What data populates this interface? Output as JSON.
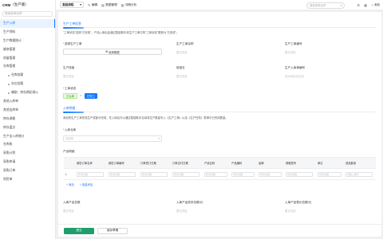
{
  "sidebar": {
    "brand": "CRM",
    "brand_sub": "（生产版）",
    "search_placeholder": "搜索菜单名称",
    "items": [
      {
        "label": "生产入库",
        "active": true
      },
      {
        "label": "生产领料"
      },
      {
        "label": "生产数据统计"
      },
      {
        "label": "维修管理"
      },
      {
        "label": "质量管理"
      },
      {
        "label": "仓库管理"
      },
      {
        "label": "仓库档案",
        "sub": true
      },
      {
        "label": "仓位档案",
        "sub": true
      },
      {
        "label": "辅助：库存期初调入",
        "sub": true
      },
      {
        "label": "其他入库单"
      },
      {
        "label": "其他出库单"
      },
      {
        "label": "库存调拨"
      },
      {
        "label": "库存盘点"
      },
      {
        "label": "生产出入库统计"
      },
      {
        "label": "仓库账"
      },
      {
        "label": "采购计划"
      },
      {
        "label": "采购申请"
      },
      {
        "label": "采购订单"
      },
      {
        "label": "到货单"
      }
    ]
  },
  "topbar": {
    "select_label": "发起流程",
    "buttons": [
      {
        "icon": "edit-icon",
        "glyph": "✎",
        "label": "编辑"
      },
      {
        "icon": "database-icon",
        "glyph": "▤",
        "label": "数据管理"
      },
      {
        "icon": "chart-icon",
        "glyph": "▥",
        "label": "流程分析"
      }
    ],
    "search_placeholder": "搜索表单名称",
    "add_label": "添加"
  },
  "form": {
    "section1_title": "生产工单信息",
    "section1_desc": "\"工单状态\"选择\"已完成\"，产品入库后会通过智能助手将生产工单中的\"工单状态\"更新为\"已完成\"。",
    "fields": {
      "select_order_label": "选择生产工单",
      "select_order_button": "选择数据",
      "order_name_label": "生产工单名称",
      "order_name_placeholder": "暂无内容",
      "order_no_label": "生产工单编号",
      "order_no_placeholder": "暂无内容",
      "product_group_label": "生产班组",
      "product_group_placeholder": "暂无内容",
      "leader_label": "班组长",
      "leader_placeholder": "暂无内容",
      "entry_no_label": "生产入库单编号",
      "entry_no_placeholder": "流水号自动生成"
    },
    "status_label": "工单状态",
    "status_options": [
      "已派单",
      "已完工"
    ],
    "section2_title": "入库明细",
    "section2_desc": "添加的生产工单完成生产或部分完成，在入库后可以通过智能助手自动将生产数量写入《生产工单》以及《生产任务》表单中已完成数量。",
    "warehouse_label": "入库仓库",
    "warehouse_placeholder": "请选择",
    "products_label": "产品明细",
    "table_headers": [
      "",
      "销售订单名称",
      "销售订单编号",
      "订单签订日期",
      "订单交付日期",
      "产品名称",
      "产品编码",
      "品牌",
      "规格型号",
      "单位",
      "成品数量"
    ],
    "table_row": [
      "1",
      "暂无内容",
      "暂无内容",
      "暂无内容",
      "暂无内容",
      "暂无内容",
      "暂无内容",
      "暂无内容",
      "暂无内容",
      "暂无内容",
      "请输入数字"
    ],
    "add_row": "+ 添加",
    "add_batch": "+ 批量添加",
    "total_qty_label": "入库产品总数",
    "total_qty_placeholder": "暂无内容",
    "total_cost_label": "入库产品成本总额/元",
    "total_cost_placeholder": "暂无内容",
    "total_price_label": "入库产品售价总额/元",
    "total_price_placeholder": "暂无内容"
  },
  "footer": {
    "submit_label": "提交",
    "save_draft_label": "保存草稿"
  },
  "colors": {
    "accent": "#1677ff",
    "submit": "#1e9e6a"
  }
}
